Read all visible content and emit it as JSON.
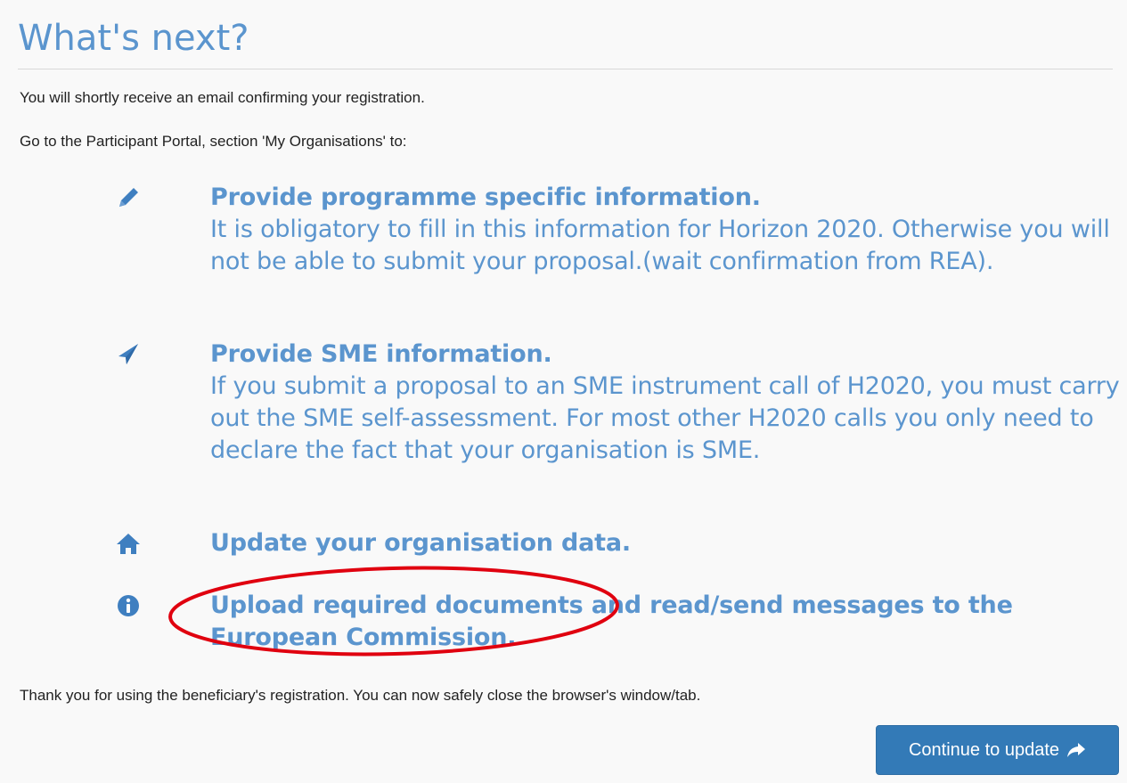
{
  "page": {
    "title": "What's next?",
    "intro_1": "You will shortly receive an email confirming your registration.",
    "intro_2": "Go to the Participant Portal, section 'My Organisations' to:"
  },
  "items": [
    {
      "icon": "pencil-icon",
      "heading": "Provide programme specific information.",
      "description": "It is obligatory to fill in this information for Horizon 2020. Otherwise you will not be able to submit your proposal.(wait confirmation from REA)."
    },
    {
      "icon": "paper-plane-icon",
      "heading": "Provide SME information.",
      "description": "If you submit a proposal to an SME instrument call of H2020, you must carry out the SME self-assessment. For most other H2020 calls you only need to declare the fact that your organisation is SME."
    },
    {
      "icon": "home-icon",
      "heading": "Update your organisation data.",
      "description": ""
    },
    {
      "icon": "info-circle-icon",
      "heading": "Upload required documents and read/send messages to the European Commission.",
      "description": ""
    }
  ],
  "closing": "Thank you for using the beneficiary's registration. You can now safely close the browser's window/tab.",
  "continue_button": {
    "label": "Continue to update",
    "icon": "share-arrow-icon"
  },
  "colors": {
    "accent_text": "#5b95ce",
    "icon": "#3f7fc0",
    "button_bg": "#337ab7",
    "annotation": "#e0000f"
  }
}
